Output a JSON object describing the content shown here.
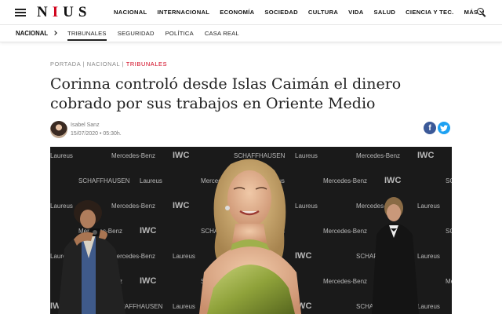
{
  "header": {
    "logo": {
      "before": "N",
      "accent": "I",
      "after": "US"
    },
    "nav": [
      "NACIONAL",
      "INTERNACIONAL",
      "ECONOMÍA",
      "SOCIEDAD",
      "CULTURA",
      "VIDA",
      "SALUD",
      "CIENCIA Y TEC."
    ],
    "more_label": "MÁS",
    "accent_color": "#d0011b"
  },
  "subnav": {
    "section": "NACIONAL",
    "items": [
      "TRIBUNALES",
      "SEGURIDAD",
      "POLÍTICA",
      "CASA REAL"
    ],
    "active": "TRIBUNALES"
  },
  "article": {
    "breadcrumb": {
      "home": "PORTADA",
      "section": "NACIONAL",
      "current": "TRIBUNALES"
    },
    "headline": "Corinna controló desde Islas Caimán el dinero cobrado por sus trabajos en Oriente Medio",
    "author": "Isabel Sanz",
    "date": "15/07/2020",
    "time": "05:30h."
  },
  "photo": {
    "wall_words": [
      "Laureus",
      "Mercedes-Benz",
      "IWC",
      "SCHAFFHAUSEN",
      "Laureus",
      "Mercedes-Benz",
      "IWC",
      "SCHAFFHAUSEN",
      "Laureus",
      "Mercedes-Benz"
    ]
  }
}
